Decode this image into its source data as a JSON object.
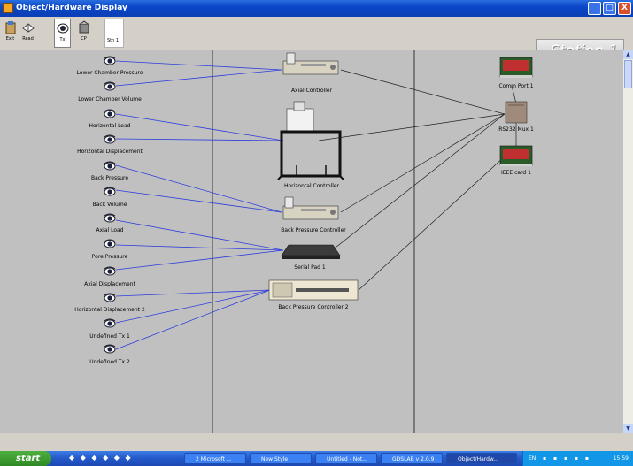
{
  "window": {
    "title": "Object/Hardware Display",
    "minimize": "_",
    "maximize": "□",
    "close": "X"
  },
  "toolbar": {
    "exit_label": "Exit",
    "read_label": "Read",
    "tx_label": "Tx",
    "cp_label": "CP",
    "stn_label": "Stn 1",
    "station_banner": "Station 1"
  },
  "transducers": [
    "Lower Chamber Pressure",
    "Lower Chamber Volume",
    "Horizontal Load",
    "Horizontal Displacement",
    "Back Pressure",
    "Back Volume",
    "Axial Load",
    "Pore Pressure",
    "Axial Displacement",
    "Horizontal Displacement 2",
    "Undefined Tx 1",
    "Undefined Tx 2"
  ],
  "controllers": [
    "Axial Controller",
    "Horizontal Controller",
    "Back Pressure Controller",
    "Serial Pad 1",
    "Back Pressure Controller 2"
  ],
  "ports": [
    "Comm Port 1",
    "RS232 Mux 1",
    "IEEE card 1"
  ],
  "colors": {
    "tx_link": "#2d3cdd",
    "port_link": "#202020",
    "canvas": "#c0c0c0",
    "titlebar": "#0a47c8"
  },
  "taskbar": {
    "start_label": "start",
    "tasks": [
      "2 Microsoft ...",
      "New Style",
      "Untitled - Not...",
      "GDSLAB v 2.0.9",
      "Object/Hardw..."
    ],
    "language": "EN",
    "clock": "15:59"
  }
}
